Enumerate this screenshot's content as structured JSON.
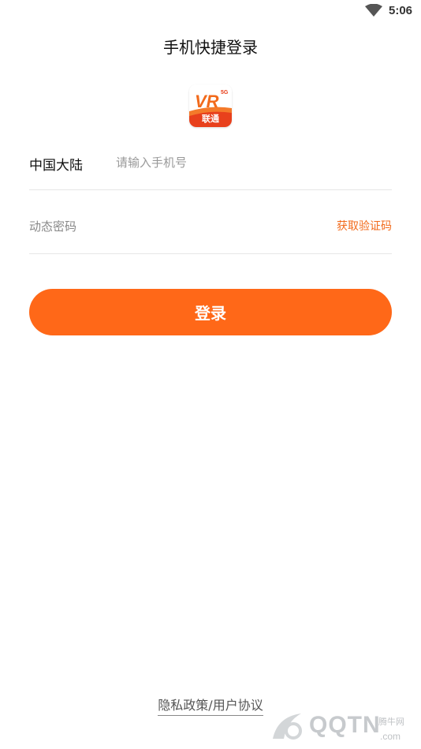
{
  "status_bar": {
    "time": "5:06",
    "wifi_icon": "wifi-icon"
  },
  "header": {
    "title": "手机快捷登录"
  },
  "logo": {
    "mark": "VR",
    "badge": "5G",
    "label": "联通",
    "icon": "app-logo-icon"
  },
  "form": {
    "region_label": "中国大陆",
    "phone_placeholder": "请输入手机号",
    "phone_value": "",
    "code_placeholder": "动态密码",
    "code_value": "",
    "get_code_label": "获取验证码"
  },
  "login_button_label": "登录",
  "footer": {
    "links_label": "隐私政策/用户协议"
  },
  "watermark": {
    "text": "QQTN",
    "sub": "腾牛网",
    "domain": ".com"
  },
  "colors": {
    "accent": "#ff6818",
    "link_accent": "#f26a1b",
    "divider": "#e6e6e6"
  }
}
